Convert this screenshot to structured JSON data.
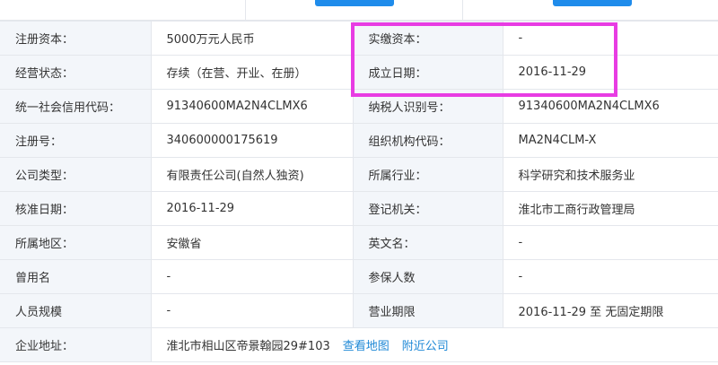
{
  "colors": {
    "label_bg": "#f3f6fa",
    "border": "#e4e7ec",
    "link": "#1e88d6",
    "highlight": "#e83ce3",
    "button": "#1f8ceb"
  },
  "rows": [
    [
      {
        "label": "注册资本：",
        "value": "5000万元人民币"
      },
      {
        "label": "实缴资本：",
        "value": "-"
      }
    ],
    [
      {
        "label": "经营状态：",
        "value": "存续（在营、开业、在册）"
      },
      {
        "label": "成立日期：",
        "value": "2016-11-29"
      }
    ],
    [
      {
        "label": "统一社会信用代码：",
        "value": "91340600MA2N4CLMX6"
      },
      {
        "label": "纳税人识别号：",
        "value": "91340600MA2N4CLMX6"
      }
    ],
    [
      {
        "label": "注册号：",
        "value": "340600000175619"
      },
      {
        "label": "组织机构代码：",
        "value": "MA2N4CLM-X"
      }
    ],
    [
      {
        "label": "公司类型：",
        "value": "有限责任公司(自然人独资)"
      },
      {
        "label": "所属行业：",
        "value": "科学研究和技术服务业"
      }
    ],
    [
      {
        "label": "核准日期：",
        "value": "2016-11-29"
      },
      {
        "label": "登记机关：",
        "value": "淮北市工商行政管理局"
      }
    ],
    [
      {
        "label": "所属地区：",
        "value": "安徽省"
      },
      {
        "label": "英文名：",
        "value": "-"
      }
    ],
    [
      {
        "label": "曾用名",
        "value": "-"
      },
      {
        "label": "参保人数",
        "value": "-"
      }
    ],
    [
      {
        "label": "人员规模",
        "value": "-"
      },
      {
        "label": "营业期限",
        "value": "2016-11-29 至 无固定期限"
      }
    ]
  ],
  "address": {
    "label": "企业地址：",
    "value": "淮北市相山区帝景翰园29#103",
    "map_link": "查看地图",
    "nearby_link": "附近公司"
  }
}
